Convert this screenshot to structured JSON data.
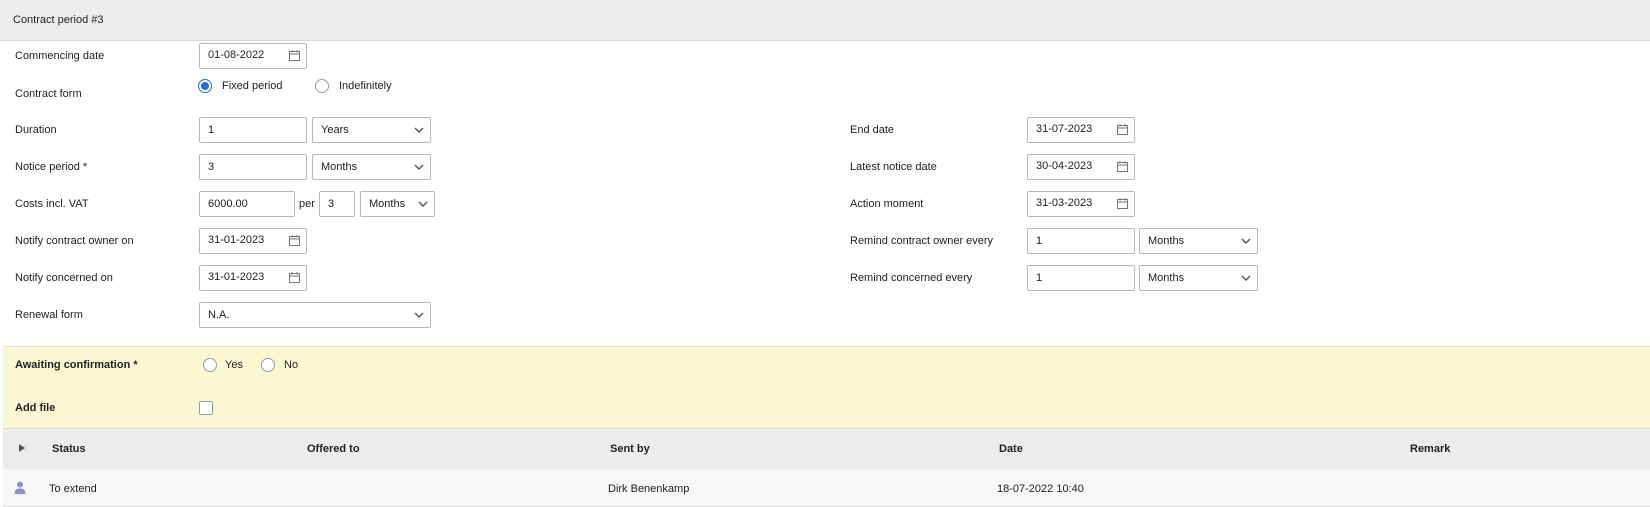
{
  "section": {
    "title": "Contract period #3"
  },
  "form": {
    "commencing_date": {
      "label": "Commencing date",
      "value": "01-08-2022"
    },
    "contract_form": {
      "label": "Contract form",
      "options": [
        "Fixed period",
        "Indefinitely"
      ],
      "selected": "Fixed period"
    },
    "duration": {
      "label": "Duration",
      "value": "1",
      "unit": "Years"
    },
    "notice_period": {
      "label": "Notice period *",
      "value": "3",
      "unit": "Months"
    },
    "costs": {
      "label": "Costs incl. VAT",
      "value": "6000.00",
      "per_label": "per",
      "per_value": "3",
      "unit": "Months"
    },
    "notify_owner": {
      "label": "Notify contract owner on",
      "value": "31-01-2023"
    },
    "notify_concerned": {
      "label": "Notify concerned on",
      "value": "31-01-2023"
    },
    "renewal_form": {
      "label": "Renewal form",
      "value": "N.A."
    },
    "end_date": {
      "label": "End date",
      "value": "31-07-2023"
    },
    "latest_notice": {
      "label": "Latest notice date",
      "value": "30-04-2023"
    },
    "action_moment": {
      "label": "Action moment",
      "value": "31-03-2023"
    },
    "remind_owner": {
      "label": "Remind contract owner every",
      "value": "1",
      "unit": "Months"
    },
    "remind_concerned": {
      "label": "Remind concerned every",
      "value": "1",
      "unit": "Months"
    }
  },
  "confirmation": {
    "awaiting_label": "Awaiting confirmation *",
    "yes_label": "Yes",
    "no_label": "No",
    "add_file_label": "Add file"
  },
  "table": {
    "columns": [
      "Status",
      "Offered to",
      "Sent by",
      "Date",
      "Remark"
    ],
    "rows": [
      {
        "status": "To extend",
        "offered_to": "",
        "sent_by": "Dirk Benenkamp",
        "date": "18-07-2022 10:40",
        "remark": ""
      }
    ]
  },
  "colors": {
    "accent": "#1e6fd0",
    "highlight_bg": "#fcf7d3",
    "header_bg": "#ececee",
    "user_icon": "#8a8fd8"
  },
  "icons": [
    "calendar-icon",
    "chevron-down-icon",
    "expand-arrow-icon",
    "user-icon"
  ]
}
